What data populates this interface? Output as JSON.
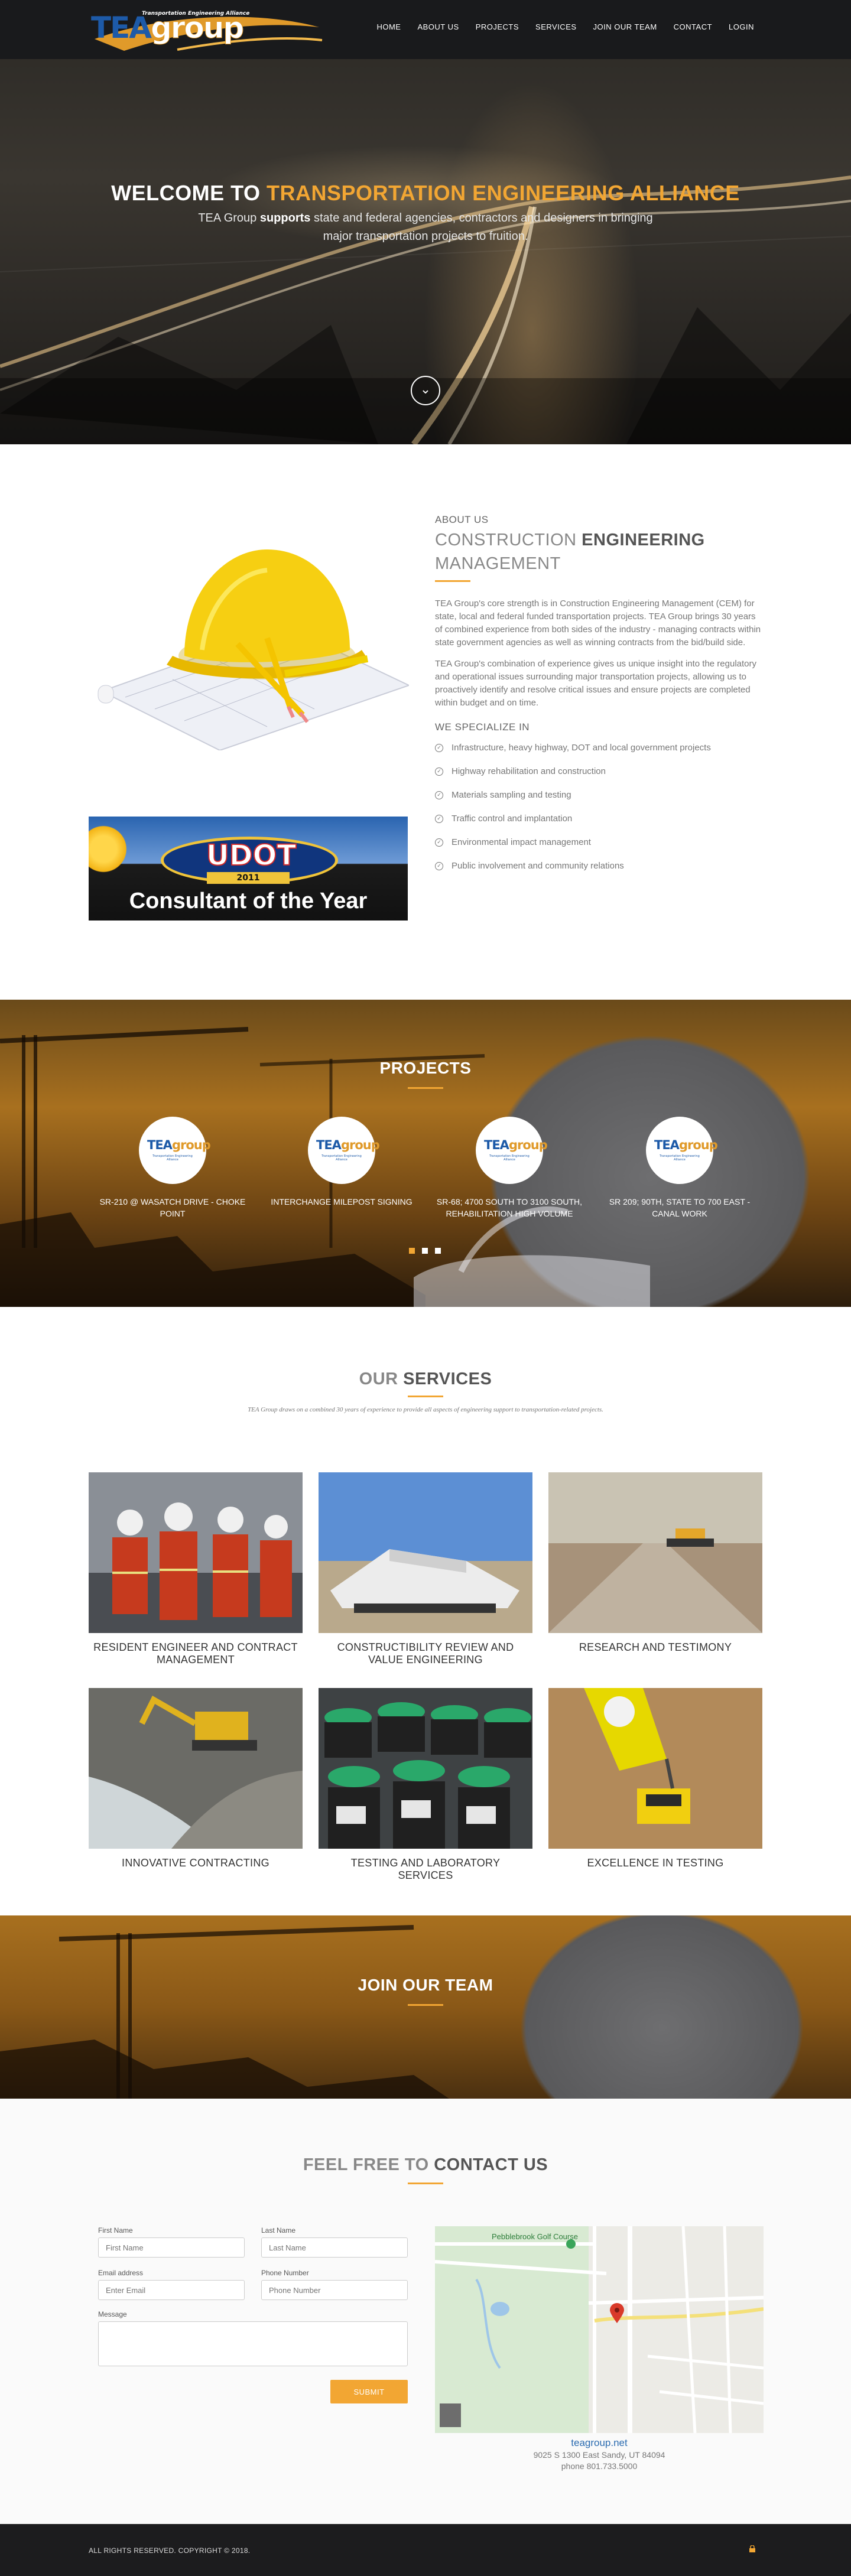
{
  "nav": {
    "logo_text_tea": "TEA",
    "logo_text_group": "group",
    "logo_tagline": "Transportation Engineering Alliance",
    "items": [
      {
        "label": "HOME"
      },
      {
        "label": "ABOUT US"
      },
      {
        "label": "PROJECTS"
      },
      {
        "label": "SERVICES"
      },
      {
        "label": "JOIN OUR TEAM"
      },
      {
        "label": "CONTACT"
      },
      {
        "label": "LOGIN"
      }
    ]
  },
  "hero": {
    "title_plain": "WELCOME TO ",
    "title_accent": "TRANSPORTATION ENGINEERING ALLIANCE",
    "sub_1": "TEA Group ",
    "sub_bold": "supports",
    "sub_2": " state and federal agencies, contractors and designers in bringing major transportation projects to fruition."
  },
  "about": {
    "udot_word": "UDOT",
    "udot_year": "2011",
    "udot_caption": "Consultant of the Year",
    "kicker": "ABOUT US",
    "heading_plain": "CONSTRUCTION ",
    "heading_bold": "ENGINEERING",
    "heading_2": "MANAGEMENT",
    "p1": "TEA Group's core strength is in Construction Engineering Management (CEM) for state, local and federal funded transportation projects. TEA Group brings 30 years of combined experience from both sides of the industry - managing contracts within state government agencies as well as winning contracts from the bid/build side.",
    "p2": "TEA Group's combination of experience gives us unique insight into the regulatory and operational issues surrounding major transportation projects, allowing us to proactively identify and resolve critical issues and ensure projects are completed within budget and on time.",
    "specialize_heading": "WE SPECIALIZE IN",
    "specialties": [
      "Infrastructure, heavy highway, DOT and local government projects",
      "Highway rehabilitation and construction",
      "Materials sampling and testing",
      "Traffic control and implantation",
      "Environmental impact management",
      "Public involvement and community relations"
    ]
  },
  "projects": {
    "title": "PROJECTS",
    "items": [
      {
        "label": "SR-210 @ WASATCH DRIVE - CHOKE POINT"
      },
      {
        "label": "INTERCHANGE MILEPOST SIGNING"
      },
      {
        "label": "SR-68; 4700 SOUTH TO 3100 SOUTH, REHABILITATION HIGH VOLUME"
      },
      {
        "label": "SR 209; 90TH, STATE TO 700 EAST - CANAL WORK"
      }
    ],
    "slides": 3,
    "active_slide": 1
  },
  "services": {
    "title_plain": "OUR ",
    "title_bold": "SERVICES",
    "intro": "TEA Group draws on a combined 30 years of experience to provide all aspects of engineering support to transportation-related projects.",
    "items": [
      {
        "label": "RESIDENT ENGINEER AND CONTRACT MANAGEMENT"
      },
      {
        "label": "CONSTRUCTIBILITY REVIEW AND VALUE ENGINEERING"
      },
      {
        "label": "RESEARCH AND TESTIMONY"
      },
      {
        "label": "INNOVATIVE CONTRACTING"
      },
      {
        "label": "TESTING AND LABORATORY SERVICES"
      },
      {
        "label": "EXCELLENCE IN TESTING"
      }
    ]
  },
  "join": {
    "title": "JOIN OUR TEAM"
  },
  "contact": {
    "title_plain": "FEEL FREE TO ",
    "title_bold": "CONTACT US",
    "first_name_label": "First Name",
    "first_name_placeholder": "First Name",
    "last_name_label": "Last Name",
    "last_name_placeholder": "Last Name",
    "email_label": "Email address",
    "email_placeholder": "Enter Email",
    "phone_label": "Phone Number",
    "phone_placeholder": "Phone Number",
    "message_label": "Message",
    "submit_label": "SUBMIT",
    "map_place": "Pebblebrook Golf Course",
    "site": "teagroup.net",
    "address": "9025 S 1300 East Sandy, UT 84094",
    "phone": "phone 801.733.5000"
  },
  "footer": {
    "copyright": "ALL RIGHTS RESERVED. COPYRIGHT © 2018."
  },
  "colors": {
    "accent": "#f2a633",
    "nav_bg": "#191a1c",
    "footer_bg": "#1c1c1e",
    "brand_blue": "#1d5aa8"
  }
}
